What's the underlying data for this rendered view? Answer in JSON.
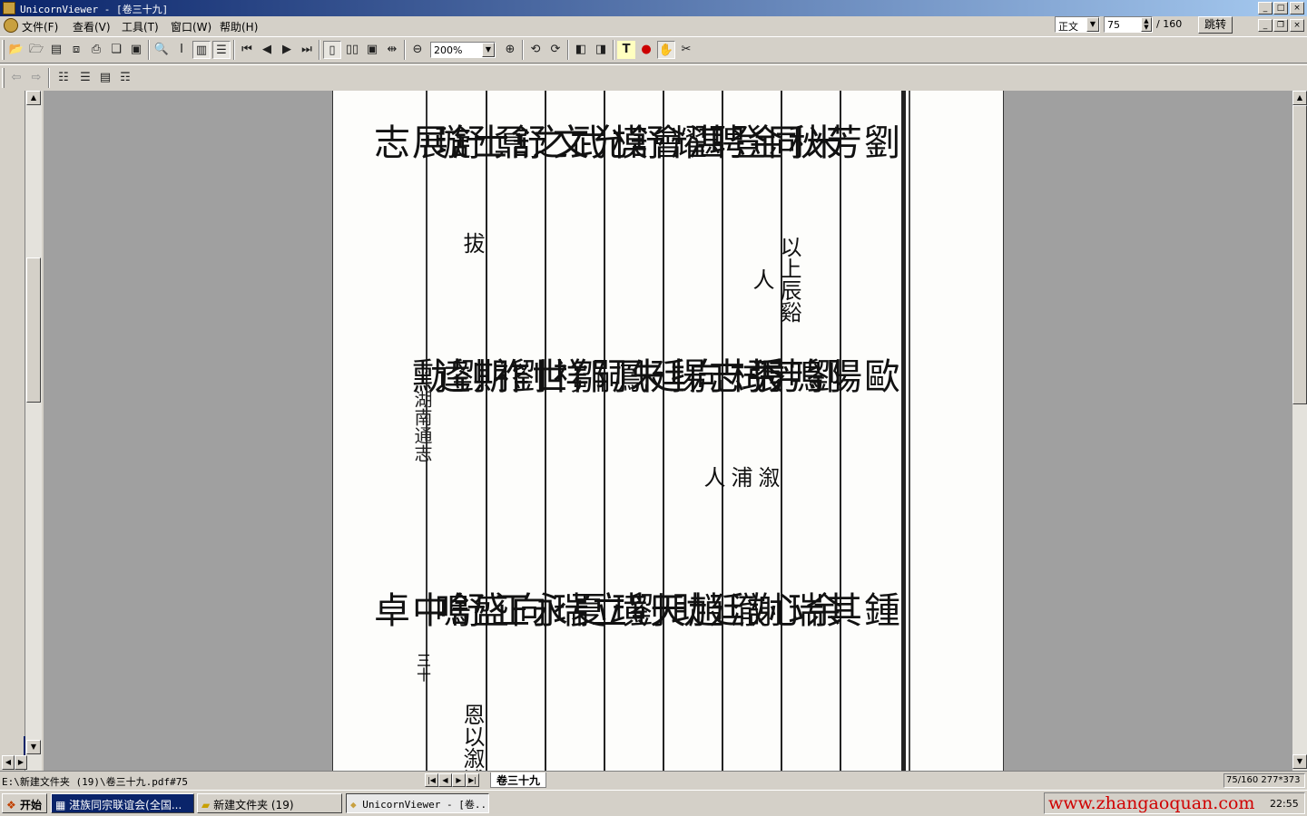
{
  "window": {
    "title": "UnicornViewer - [卷三十九]",
    "caption_buttons": [
      "_",
      "□",
      "×"
    ]
  },
  "menu": {
    "items": [
      "文件(F)",
      "查看(V)",
      "工具(T)",
      "窗口(W)",
      "帮助(H)"
    ],
    "mode_select": "正文",
    "page_input": "75",
    "page_total": "/ 160",
    "jump_label": "跳转"
  },
  "toolbar": {
    "zoom_value": "200%"
  },
  "document": {
    "margin_text": "湖南通志",
    "margin_page": "三十",
    "columns": [
      {
        "names": [
          "劉芳秋",
          "歐陽鳴秀",
          "鍾其瑞"
        ],
        "notes": []
      },
      {
        "names": [
          "米同登",
          "劉芳栻",
          "余心澈"
        ],
        "notes": []
      },
      {
        "names": [
          "金聘耀",
          "張志揚",
          "謝廷助"
        ],
        "notes": [
          "以上辰谿人",
          "溆浦人"
        ]
      },
      {
        "names": [
          "湛會模",
          "向廷鳳",
          "趙天璜"
        ],
        "notes": []
      },
      {
        "names": [
          "舒允文",
          "朱嗣祥",
          "劉立瑞"
        ],
        "notes": []
      },
      {
        "names": [
          "武之鼐",
          "鄒世祚",
          "夏永正"
        ],
        "notes": []
      },
      {
        "names": [
          "舒士璇",
          "劉期逵",
          "向盛鳴"
        ],
        "notes": []
      },
      {
        "names": [
          "舒展志",
          "劉 勳",
          "舒中卓"
        ],
        "notes": [
          "拔",
          "恩以溆浦"
        ]
      }
    ]
  },
  "status": {
    "path": "E:\\新建文件夹 (19)\\卷三十九.pdf#75",
    "sheet_tab": "卷三十九",
    "page_info": "75/160 277*373"
  },
  "taskbar": {
    "start": "开始",
    "tasks": [
      "湛族同宗联谊会(全国...",
      "新建文件夹 (19)",
      "UnicornViewer - [卷..."
    ],
    "watermark": "www.zhangaoquan.com",
    "clock": "22:55"
  },
  "colors": {
    "title_start": "#0a246a",
    "title_end": "#a6caf0",
    "chrome": "#d4d0c8",
    "doc_bg": "#a0a0a0",
    "watermark": "#d00000"
  }
}
